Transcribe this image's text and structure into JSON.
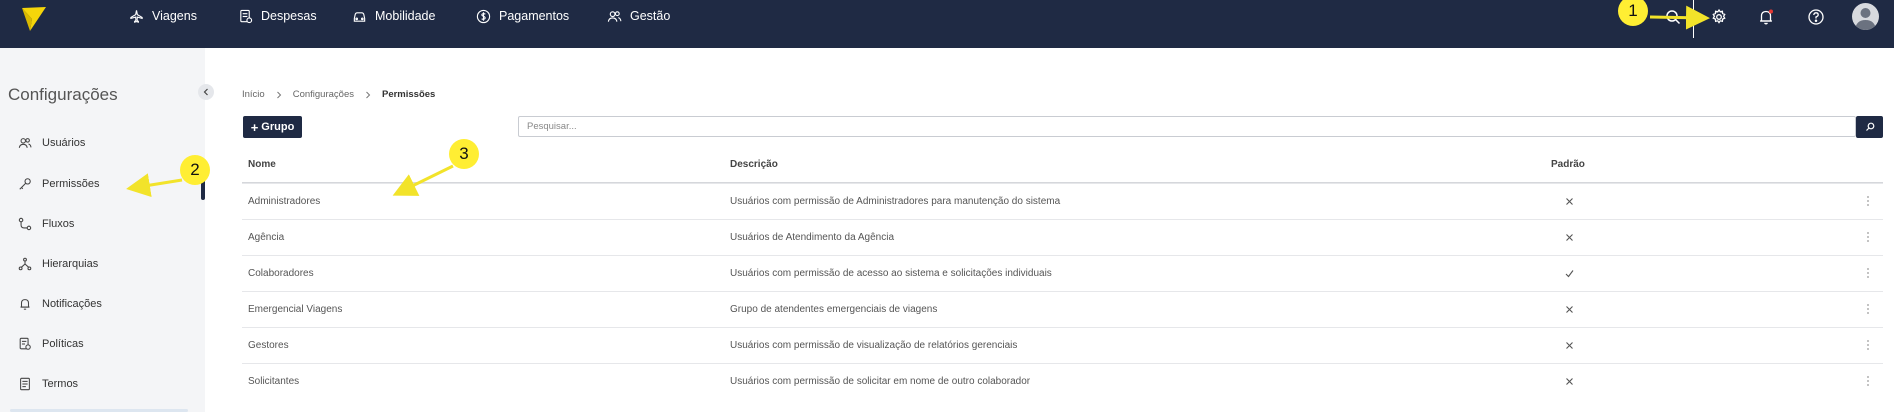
{
  "nav": {
    "items": [
      {
        "label": "Viagens",
        "icon": "plane-icon"
      },
      {
        "label": "Despesas",
        "icon": "receipt-icon"
      },
      {
        "label": "Mobilidade",
        "icon": "car-icon"
      },
      {
        "label": "Pagamentos",
        "icon": "dollar-icon"
      },
      {
        "label": "Gestão",
        "icon": "users-icon"
      }
    ],
    "right_icons": [
      "search-icon",
      "gear-icon",
      "bell-icon",
      "help-icon",
      "avatar-icon"
    ]
  },
  "sidebar": {
    "title": "Configurações",
    "items": [
      {
        "label": "Usuários",
        "icon": "users-icon"
      },
      {
        "label": "Permissões",
        "icon": "key-icon"
      },
      {
        "label": "Fluxos",
        "icon": "flow-icon"
      },
      {
        "label": "Hierarquias",
        "icon": "hierarchy-icon"
      },
      {
        "label": "Notificações",
        "icon": "bell-icon"
      },
      {
        "label": "Políticas",
        "icon": "policy-icon"
      },
      {
        "label": "Termos",
        "icon": "document-icon"
      }
    ],
    "active_item": "Permissões"
  },
  "breadcrumb": [
    "Início",
    "Configurações",
    "Permissões"
  ],
  "actions": {
    "add_group_plus": "+",
    "add_group_label": "Grupo",
    "search_placeholder": "Pesquisar..."
  },
  "table": {
    "headers": [
      "Nome",
      "Descrição",
      "Padrão"
    ],
    "rows": [
      {
        "name": "Administradores",
        "description": "Usuários com permissão de Administradores para manutenção do sistema",
        "default": false
      },
      {
        "name": "Agência",
        "description": "Usuários de Atendimento da Agência",
        "default": false
      },
      {
        "name": "Colaboradores",
        "description": "Usuários com permissão de acesso ao sistema e solicitações individuais",
        "default": true
      },
      {
        "name": "Emergencial Viagens",
        "description": "Grupo de atendentes emergenciais de viagens",
        "default": false
      },
      {
        "name": "Gestores",
        "description": "Usuários com permissão de visualização de relatórios gerenciais",
        "default": false
      },
      {
        "name": "Solicitantes",
        "description": "Usuários com permissão de solicitar em nome de outro colaborador",
        "default": false
      }
    ]
  },
  "annotations": [
    "1",
    "2",
    "3"
  ],
  "colors": {
    "navbar": "#1f2a44",
    "sidebar": "#f4f5f7",
    "callout": "#ffee33",
    "notification_dot": "#e53935"
  }
}
